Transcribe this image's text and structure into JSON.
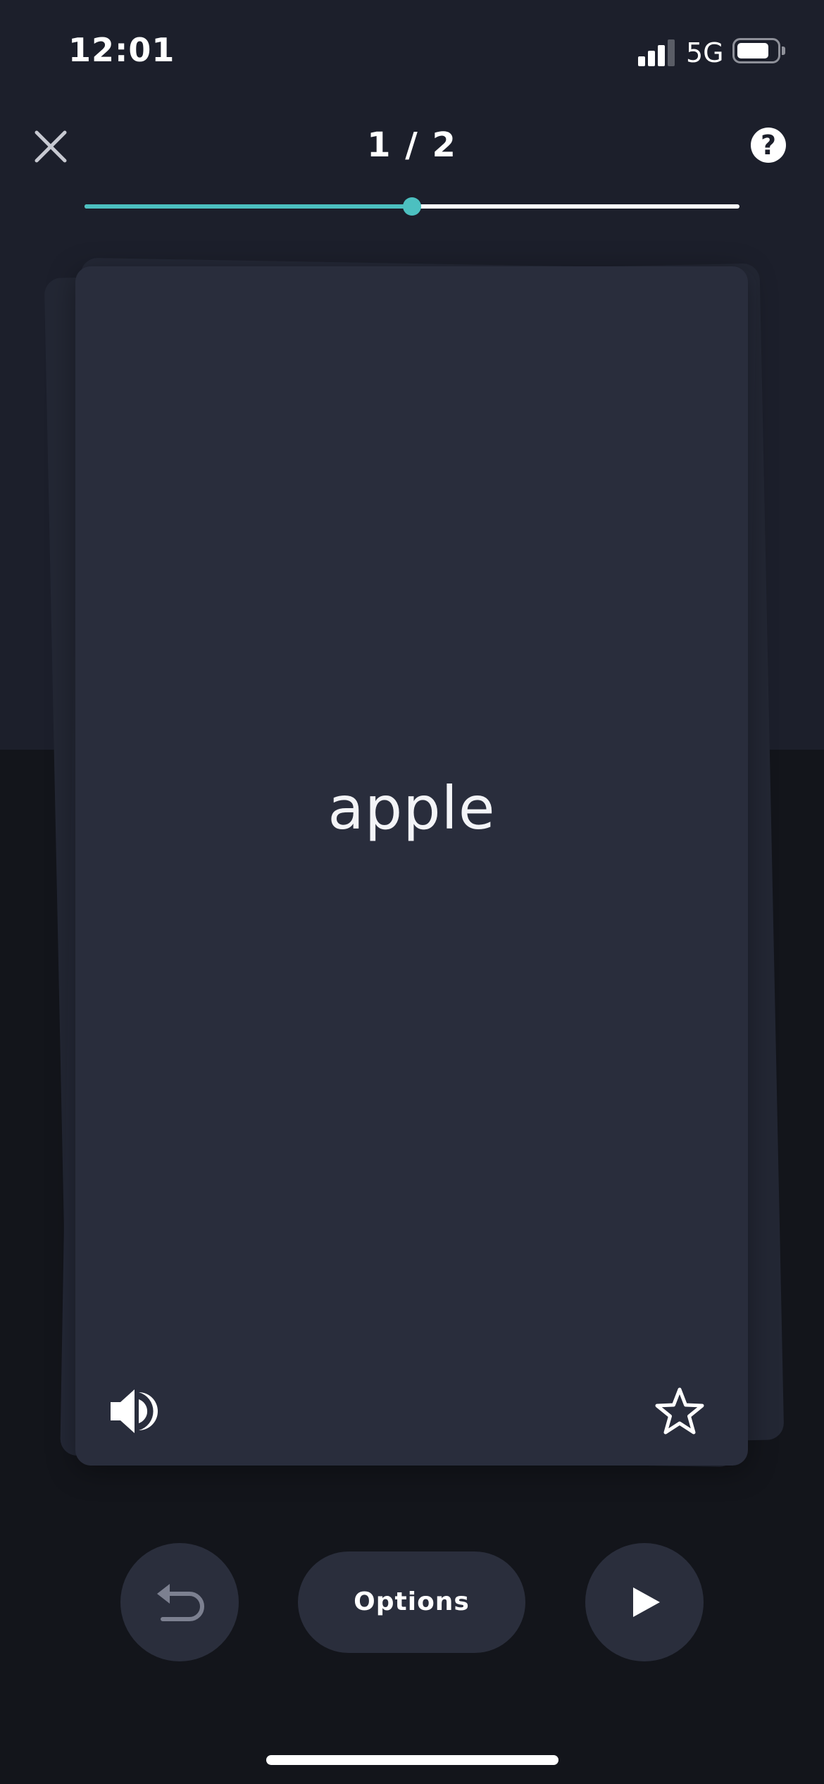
{
  "status_bar": {
    "time": "12:01",
    "network": "5G",
    "icons": [
      "signal-icon",
      "battery-icon"
    ]
  },
  "header": {
    "counter": "1 / 2",
    "close_icon": "close-icon",
    "help_label": "?",
    "help_icon": "help-icon"
  },
  "progress": {
    "fraction": 0.5,
    "accent_color": "#4cc0c0"
  },
  "card": {
    "term": "apple",
    "audio_icon": "speaker-icon",
    "star_icon": "star-icon"
  },
  "controls": {
    "undo_icon": "undo-icon",
    "options_label": "Options",
    "play_icon": "play-icon"
  },
  "colors": {
    "background_top": "#1c1f2b",
    "background_bottom": "#13151b",
    "card": "#292d3c",
    "button": "#2a2e3c"
  }
}
